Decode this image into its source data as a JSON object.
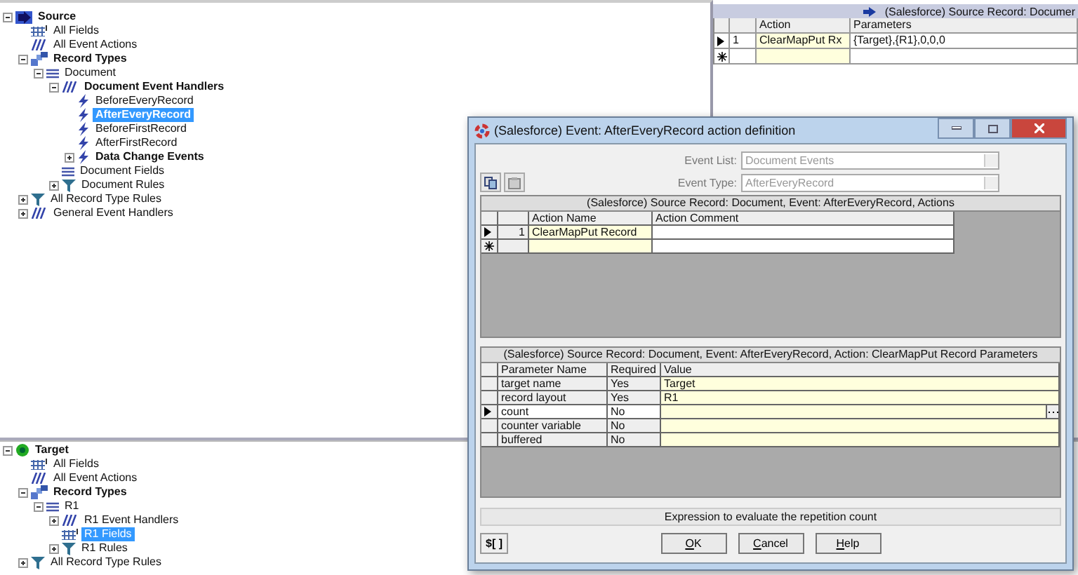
{
  "source_tree": {
    "label": "Source",
    "kind": "source",
    "bold": true,
    "expanded": true,
    "selected": false,
    "children": [
      {
        "label": "All Fields",
        "kind": "fields",
        "bold": false,
        "selected": false
      },
      {
        "label": "All Event Actions",
        "kind": "actions",
        "bold": false,
        "selected": false
      },
      {
        "label": "Record Types",
        "kind": "record-types",
        "bold": true,
        "expanded": true,
        "selected": false,
        "children": [
          {
            "label": "Document",
            "kind": "record",
            "bold": false,
            "expanded": true,
            "selected": false,
            "children": [
              {
                "label": "Document Event Handlers",
                "kind": "actions",
                "bold": true,
                "expanded": true,
                "selected": false,
                "children": [
                  {
                    "label": "BeforeEveryRecord",
                    "kind": "event",
                    "bold": false,
                    "selected": false
                  },
                  {
                    "label": "AfterEveryRecord",
                    "kind": "event",
                    "bold": true,
                    "selected": true
                  },
                  {
                    "label": "BeforeFirstRecord",
                    "kind": "event",
                    "bold": false,
                    "selected": false
                  },
                  {
                    "label": "AfterFirstRecord",
                    "kind": "event",
                    "bold": false,
                    "selected": false
                  },
                  {
                    "label": "Data Change Events",
                    "kind": "event",
                    "bold": true,
                    "expanded": false,
                    "selected": false
                  }
                ]
              },
              {
                "label": "Document Fields",
                "kind": "record",
                "bold": false,
                "selected": false
              },
              {
                "label": "Document Rules",
                "kind": "rules",
                "bold": false,
                "expanded": false,
                "selected": false
              }
            ]
          }
        ]
      },
      {
        "label": "All Record Type Rules",
        "kind": "rules",
        "bold": false,
        "expanded": false,
        "selected": false
      },
      {
        "label": "General Event Handlers",
        "kind": "actions",
        "bold": false,
        "expanded": false,
        "selected": false
      }
    ]
  },
  "actions_panel": {
    "title": "(Salesforce) Source Record: Documer",
    "columns": [
      "Action",
      "Parameters"
    ],
    "rows": [
      {
        "number": "1",
        "action": "ClearMapPut Rx",
        "parameters": "{Target},{R1},0,0,0",
        "current": true
      }
    ]
  },
  "target_tree": {
    "label": "Target",
    "kind": "target",
    "bold": true,
    "expanded": true,
    "selected": false,
    "children": [
      {
        "label": "All Fields",
        "kind": "fields",
        "bold": false,
        "selected": false
      },
      {
        "label": "All Event Actions",
        "kind": "actions",
        "bold": false,
        "selected": false
      },
      {
        "label": "Record Types",
        "kind": "record-types",
        "bold": true,
        "expanded": true,
        "selected": false,
        "children": [
          {
            "label": "R1",
            "kind": "record",
            "bold": false,
            "expanded": true,
            "selected": false,
            "children": [
              {
                "label": "R1 Event Handlers",
                "kind": "actions",
                "bold": false,
                "expanded": false,
                "selected": false
              },
              {
                "label": "R1 Fields",
                "kind": "fields",
                "bold": false,
                "selected": true
              },
              {
                "label": "R1 Rules",
                "kind": "rules",
                "bold": false,
                "expanded": false,
                "selected": false
              }
            ]
          }
        ]
      },
      {
        "label": "All Record Type Rules",
        "kind": "rules",
        "bold": false,
        "expanded": false,
        "selected": false
      }
    ]
  },
  "dialog": {
    "title": "(Salesforce) Event: AfterEveryRecord action definition",
    "event_list": {
      "label": "Event List:",
      "value": "Document Events"
    },
    "event_type": {
      "label": "Event Type:",
      "value": "AfterEveryRecord"
    },
    "actions_grid": {
      "title": "(Salesforce) Source Record: Document, Event: AfterEveryRecord, Actions",
      "columns": [
        "Action Name",
        "Action Comment"
      ],
      "rows": [
        {
          "number": "1",
          "name": "ClearMapPut Record",
          "comment": "",
          "current": true
        }
      ]
    },
    "parameters_grid": {
      "title": "(Salesforce) Source Record: Document, Event: AfterEveryRecord, Action: ClearMapPut Record Parameters",
      "columns": [
        "Parameter Name",
        "Required",
        "Value"
      ],
      "rows": [
        {
          "name": "target name",
          "required": "Yes",
          "value": "Target",
          "current": false
        },
        {
          "name": "record layout",
          "required": "Yes",
          "value": "R1",
          "current": false
        },
        {
          "name": "count",
          "required": "No",
          "value": "",
          "current": true
        },
        {
          "name": "counter variable",
          "required": "No",
          "value": "",
          "current": false
        },
        {
          "name": "buffered",
          "required": "No",
          "value": "",
          "current": false
        }
      ]
    },
    "hint": "Expression to evaluate the repetition count",
    "expression_button": "$[ ]",
    "buttons": [
      "OK",
      "Cancel",
      "Help"
    ]
  }
}
